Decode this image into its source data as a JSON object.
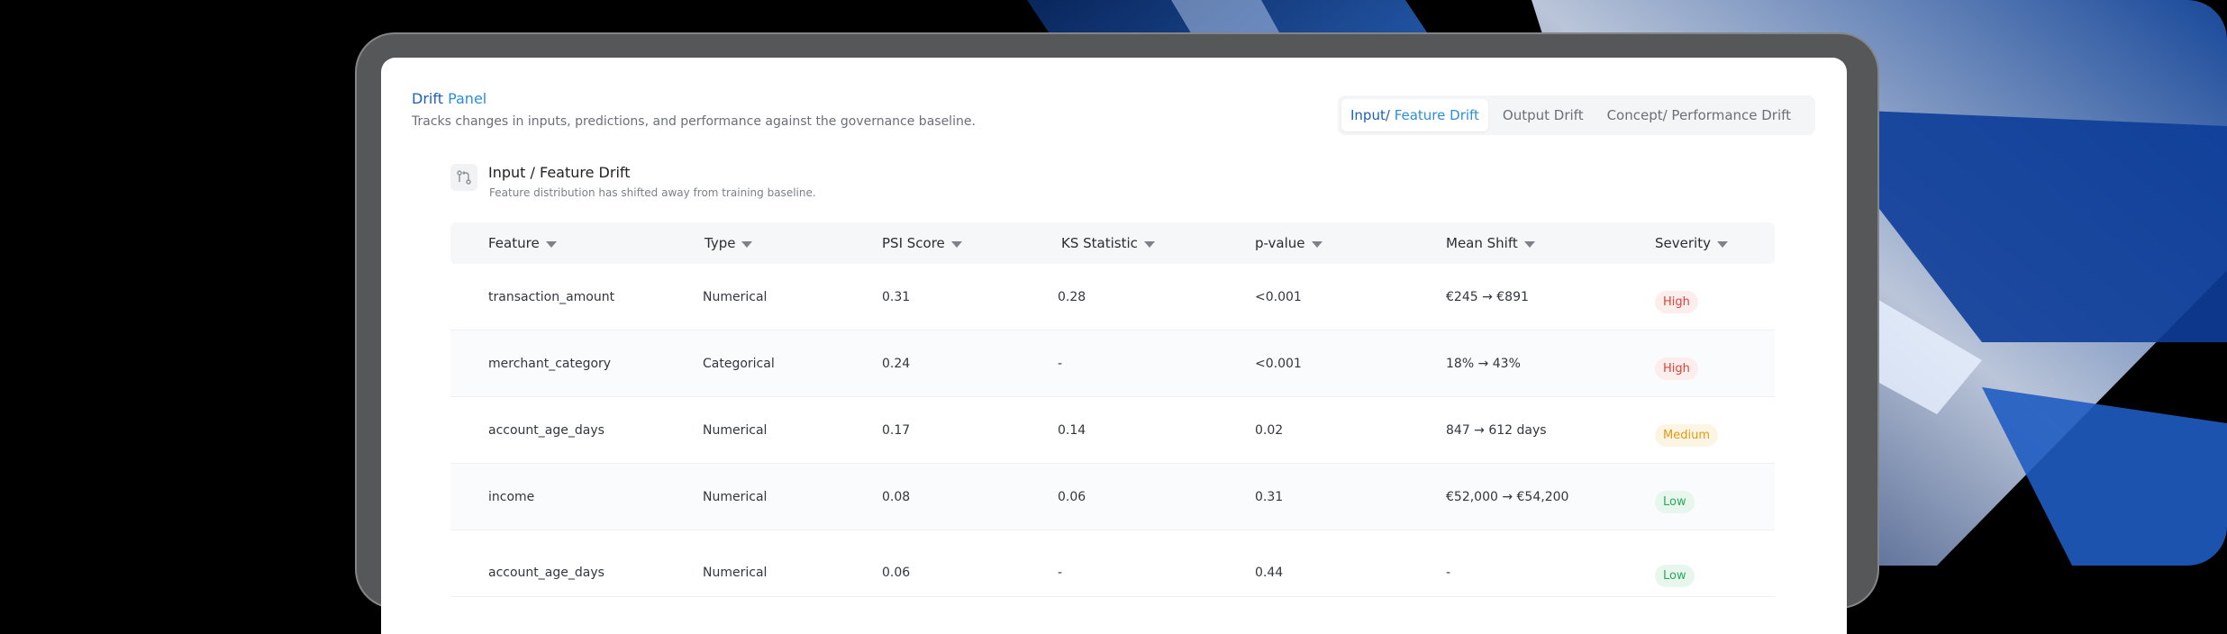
{
  "panel": {
    "title_main": "Drift",
    "title_accent": "Panel",
    "subtitle": "Tracks changes in inputs, predictions, and performance against the governance baseline."
  },
  "tabs": [
    {
      "label_main": "Input/",
      "label_accent": "Feature Drift",
      "active": true
    },
    {
      "label": "Output Drift",
      "active": false
    },
    {
      "label": "Concept/ Performance Drift",
      "active": false
    }
  ],
  "section": {
    "icon": "git-compare-icon",
    "title": "Input / Feature Drift",
    "description": "Feature distribution has shifted away from training baseline."
  },
  "table": {
    "columns": [
      "Feature",
      "Type",
      "PSI Score",
      "KS Statistic",
      "p-value",
      "Mean Shift",
      "Severity"
    ],
    "rows": [
      {
        "feature": "transaction_amount",
        "type": "Numerical",
        "psi": "0.31",
        "ks": "0.28",
        "p_value": "<0.001",
        "mean_shift": "€245 → €891",
        "severity": "High"
      },
      {
        "feature": "merchant_category",
        "type": "Categorical",
        "psi": "0.24",
        "ks": "-",
        "p_value": "<0.001",
        "mean_shift": "18% → 43%",
        "severity": "High"
      },
      {
        "feature": "account_age_days",
        "type": "Numerical",
        "psi": "0.17",
        "ks": "0.14",
        "p_value": "0.02",
        "mean_shift": "847 → 612 days",
        "severity": "Medium"
      },
      {
        "feature": "income",
        "type": "Numerical",
        "psi": "0.08",
        "ks": "0.06",
        "p_value": "0.31",
        "mean_shift": "€52,000 → €54,200",
        "severity": "Low"
      },
      {
        "feature": "account_age_days",
        "type": "Numerical",
        "psi": "0.06",
        "ks": "-",
        "p_value": "0.44",
        "mean_shift": "-",
        "severity": "Low"
      }
    ]
  },
  "colors": {
    "accent_blue": "#1e5fb8",
    "accent_light_blue": "#2c8fd6",
    "severity_high": "#e0413b",
    "severity_medium": "#e29a14",
    "severity_low": "#2ea85c"
  }
}
